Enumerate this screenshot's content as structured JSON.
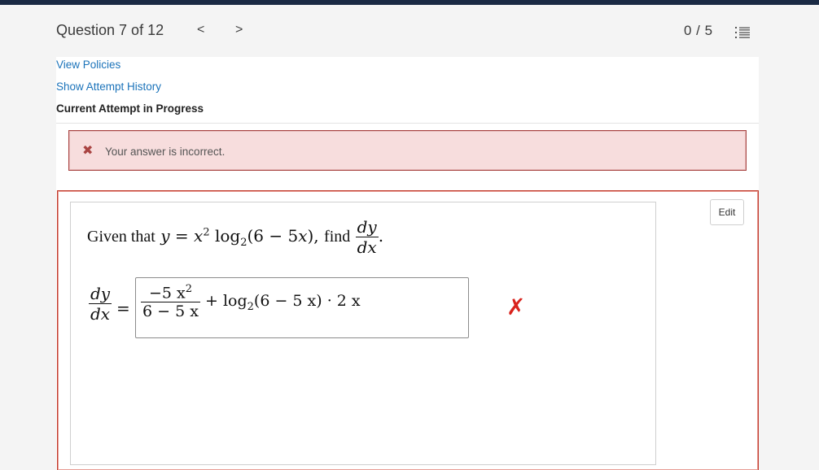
{
  "header": {
    "question_label": "Question 7 of 12",
    "prev_arrow": "<",
    "next_arrow": ">",
    "score": "0 / 5"
  },
  "links": {
    "view_policies": "View Policies",
    "show_attempt_history": "Show Attempt History",
    "status": "Current Attempt in Progress"
  },
  "alert": {
    "icon": "✖",
    "message": "Your answer is incorrect."
  },
  "question": {
    "edit_label": "Edit",
    "given_text": "Given that",
    "find_text": "find",
    "result_icon": "✗"
  },
  "answer": {
    "frac_num": "−5 x",
    "frac_num_exp": "2",
    "frac_den": "6 − 5 x",
    "rest_log": "+ log",
    "rest_base": "2",
    "rest_tail": "(6 − 5 x) · 2 x"
  },
  "colors": {
    "top_bar": "#1a2a44",
    "link": "#1b73ba",
    "error": "#a94442",
    "alert_bg": "#f7dddd",
    "wrong_mark": "#d9231d"
  }
}
